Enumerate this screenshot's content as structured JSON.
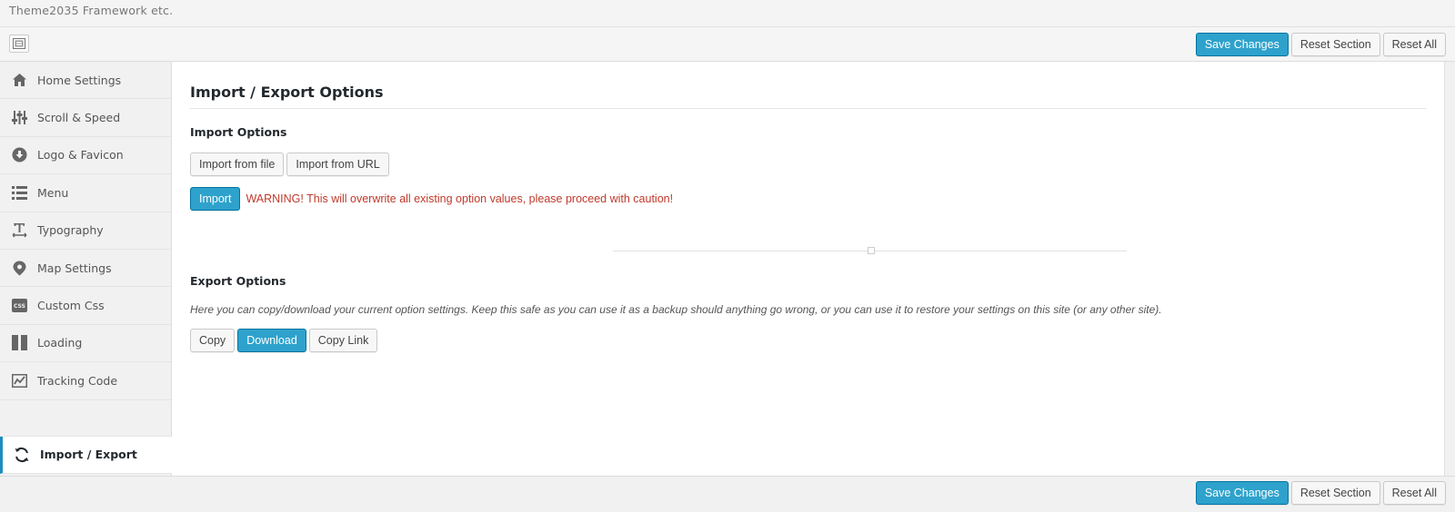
{
  "app": {
    "title": "Theme2035 Framework etc."
  },
  "toolbar": {
    "save_label": "Save Changes",
    "reset_section_label": "Reset Section",
    "reset_all_label": "Reset All"
  },
  "sidebar": {
    "items": [
      {
        "label": "Home Settings",
        "icon": "home-icon"
      },
      {
        "label": "Scroll & Speed",
        "icon": "sliders-icon"
      },
      {
        "label": "Logo & Favicon",
        "icon": "download-icon"
      },
      {
        "label": "Menu",
        "icon": "list-icon"
      },
      {
        "label": "Typography",
        "icon": "text-icon"
      },
      {
        "label": "Map Settings",
        "icon": "map-pin-icon"
      },
      {
        "label": "Custom Css",
        "icon": "css-icon"
      },
      {
        "label": "Loading",
        "icon": "columns-icon"
      },
      {
        "label": "Tracking Code",
        "icon": "chart-icon"
      },
      {
        "label": "Import / Export",
        "icon": "refresh-icon",
        "active": true
      }
    ]
  },
  "main": {
    "title": "Import / Export Options",
    "import": {
      "heading": "Import Options",
      "from_file_label": "Import from file",
      "from_url_label": "Import from URL",
      "import_label": "Import",
      "warning": "WARNING! This will overwrite all existing option values, please proceed with caution!"
    },
    "export": {
      "heading": "Export Options",
      "description": "Here you can copy/download your current option settings. Keep this safe as you can use it as a backup should anything go wrong, or you can use it to restore your settings on this site (or any other site).",
      "copy_label": "Copy",
      "download_label": "Download",
      "copy_link_label": "Copy Link"
    }
  },
  "colors": {
    "primary": "#2ea2cc",
    "active_border": "#1e8cbe",
    "warning": "#c0392b"
  }
}
